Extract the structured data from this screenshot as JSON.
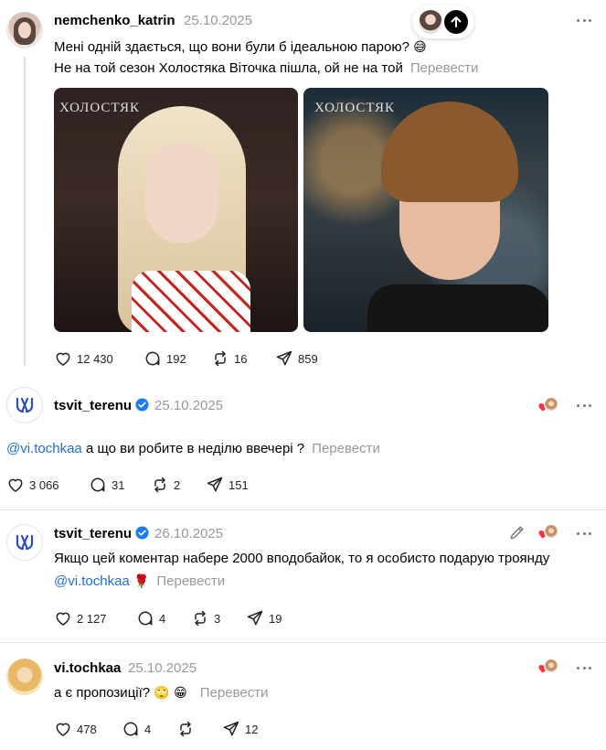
{
  "floating": {
    "scroll_top_label": ""
  },
  "posts": [
    {
      "username": "nemchenko_katrin",
      "date": "25.10.2025",
      "line1": "Мені одній здається, що вони були б ідеальною парою?",
      "line1_emoji": "😅",
      "line2": "Не на той сезон Холостяка Віточка пішла, ой не на той",
      "translate": "Перевести",
      "watermark": "ХОЛОСТЯК",
      "likes": "12 430",
      "comments": "192",
      "reposts": "16",
      "shares": "859"
    },
    {
      "username": "tsvit_terenu",
      "date": "25.10.2025",
      "mention": "@vi.tochkaa",
      "text": "а що ви робите в неділю ввечері ?",
      "translate": "Перевести",
      "likes": "3 066",
      "comments": "31",
      "reposts": "2",
      "shares": "151"
    },
    {
      "username": "tsvit_terenu",
      "date": "26.10.2025",
      "line1": "Якщо цей коментар набере 2000 вподобайок, то я особисто подарую троянду",
      "mention": "@vi.tochkaa",
      "emoji": "🌹",
      "translate": "Перевести",
      "likes": "2 127",
      "comments": "4",
      "reposts": "3",
      "shares": "19"
    },
    {
      "username": "vi.tochkaa",
      "date": "25.10.2025",
      "text": "а є пропозиції?",
      "emoji": "🙄 😁",
      "translate": "Перевести",
      "likes": "478",
      "comments": "4",
      "reposts": "",
      "shares": "12"
    }
  ],
  "colors": {
    "mention": "#1d6fd8",
    "verified": "#1a7cf5",
    "heart_red": "#ff3040",
    "muted": "#999999"
  }
}
